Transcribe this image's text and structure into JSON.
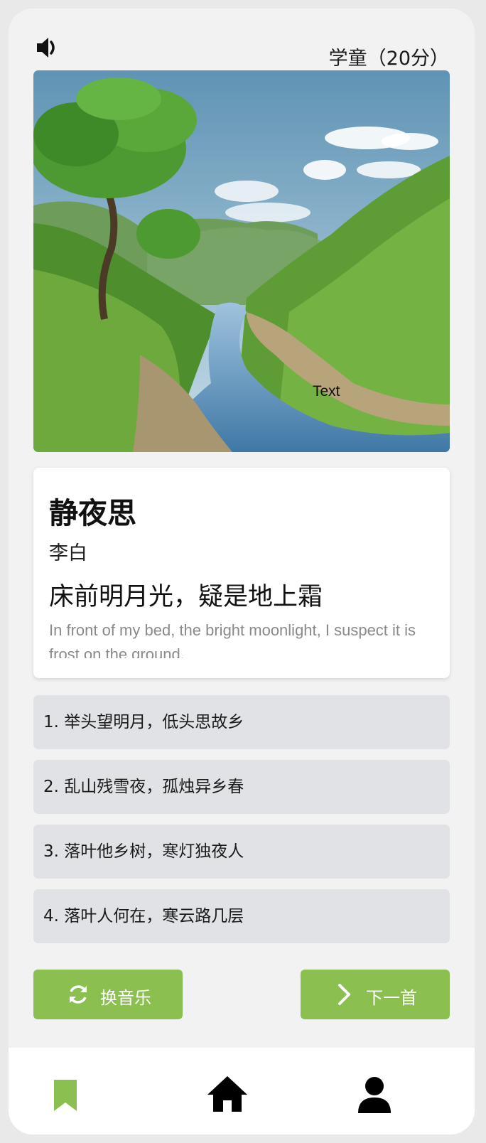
{
  "header": {
    "sound_icon": "speaker-icon",
    "level_label": "学童（20分）"
  },
  "hero": {
    "image_description_icon": "landscape-image",
    "caption": "Text"
  },
  "poem": {
    "title": "静夜思",
    "author": "李白",
    "line": "床前明月光，疑是地上霜",
    "translation": "In front of my bed, the bright moonlight, I suspect it is frost on the ground."
  },
  "options": [
    {
      "label": "1. 举头望明月，低头思故乡"
    },
    {
      "label": "2. 乱山残雪夜，孤烛异乡春"
    },
    {
      "label": "3. 落叶他乡树，寒灯独夜人"
    },
    {
      "label": "4. 落叶人何在，寒云路几层"
    }
  ],
  "actions": {
    "change_music_label": "换音乐",
    "change_music_icon": "refresh-icon",
    "next_label": "下一首",
    "next_icon": "chevron-right-icon"
  },
  "nav": {
    "items": [
      {
        "icon": "bookmark-icon",
        "active": true
      },
      {
        "icon": "home-icon",
        "active": false
      },
      {
        "icon": "user-icon",
        "active": false
      }
    ],
    "active_color": "#8bc050",
    "inactive_color": "#000000"
  },
  "colors": {
    "accent": "#8bc050",
    "option_bg": "#e1e2e6"
  }
}
